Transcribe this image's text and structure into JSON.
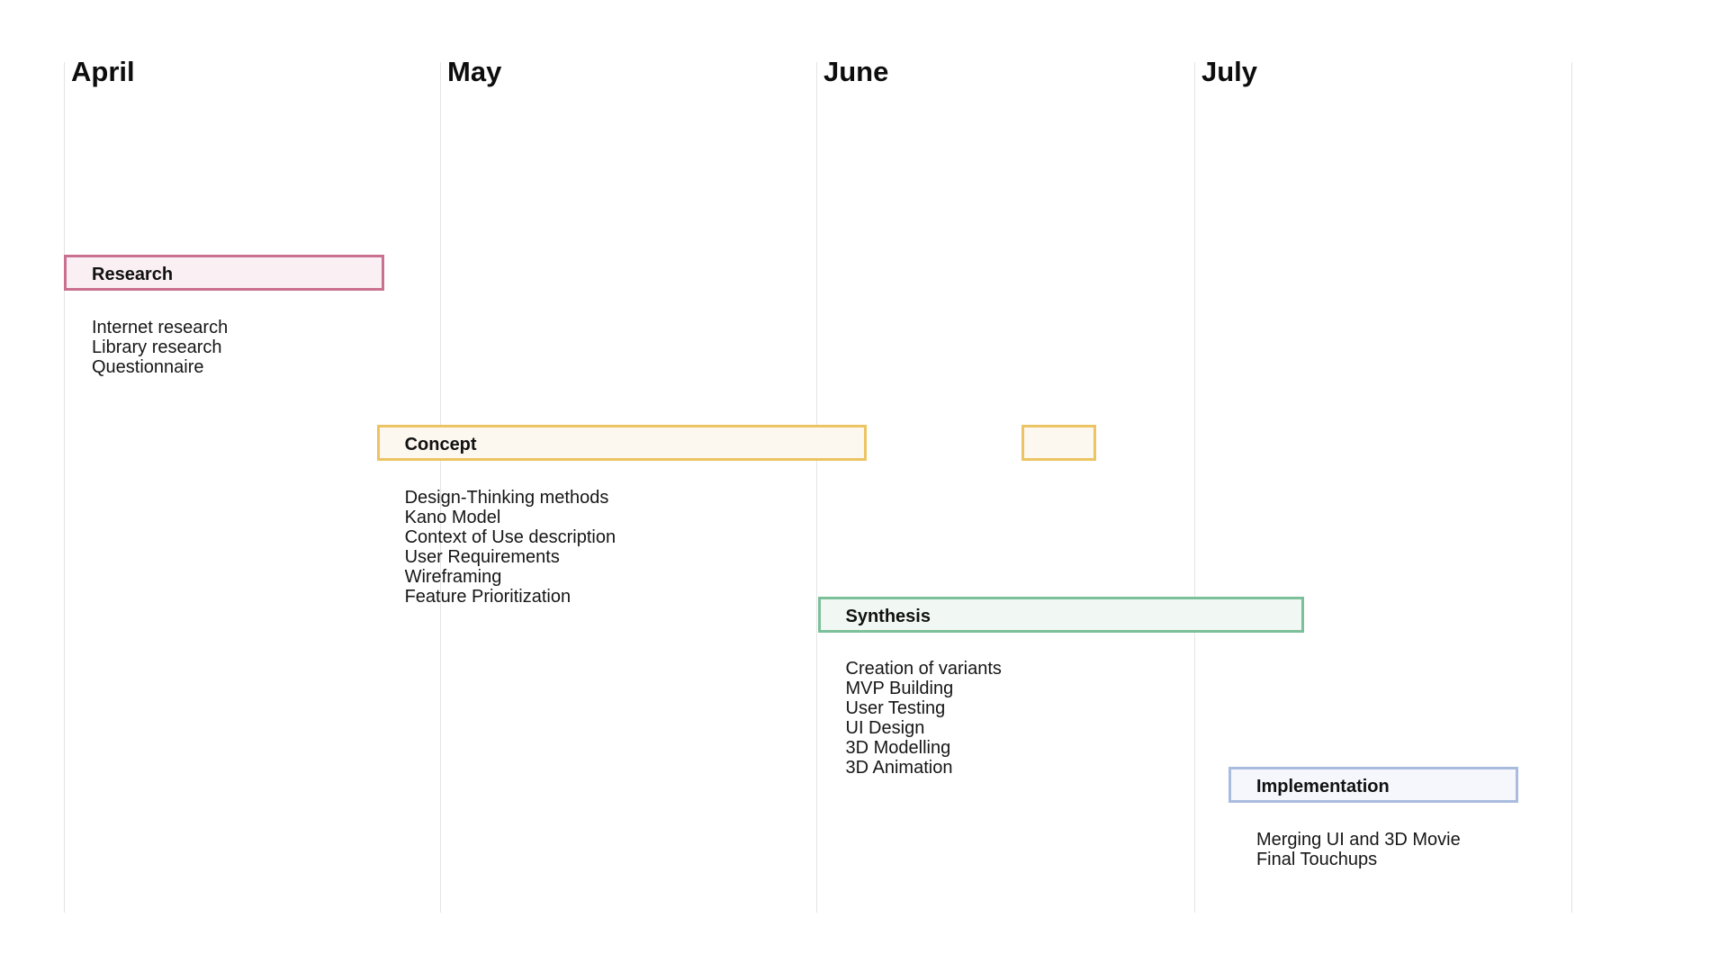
{
  "timeline": {
    "months": [
      "April",
      "May",
      "June",
      "July"
    ],
    "unit": "months from start of April",
    "phases": [
      {
        "id": "research",
        "title": "Research",
        "start": 0.0,
        "end": 0.85,
        "border_color": "#CA7090",
        "fill_color": "#FAEFF3",
        "items": [
          "Internet research",
          "Library research",
          "Questionnaire"
        ]
      },
      {
        "id": "concept",
        "title": "Concept",
        "start": 0.83,
        "end": 2.13,
        "border_color": "#ECC463",
        "fill_color": "#FCF7EF",
        "items": [
          "Design-Thinking methods",
          "Kano Model",
          "Context of Use description",
          "User Requirements",
          "Wireframing",
          "Feature Prioritization"
        ]
      },
      {
        "id": "concept-extension",
        "title": "",
        "start": 2.54,
        "end": 2.74,
        "border_color": "#ECC463",
        "fill_color": "#FCF7EF",
        "items": []
      },
      {
        "id": "synthesis",
        "title": "Synthesis",
        "start": 2.0,
        "end": 3.29,
        "border_color": "#7CC09A",
        "fill_color": "#F1F8F3",
        "items": [
          "Creation of variants",
          "MVP Building",
          "User Testing",
          "UI Design",
          "3D Modelling",
          "3D Animation"
        ]
      },
      {
        "id": "implementation",
        "title": "Implementation",
        "start": 3.09,
        "end": 3.86,
        "border_color": "#A9BCDE",
        "fill_color": "#F5F7FC",
        "items": [
          "Merging UI and 3D Movie",
          "Final Touchups"
        ]
      }
    ]
  }
}
